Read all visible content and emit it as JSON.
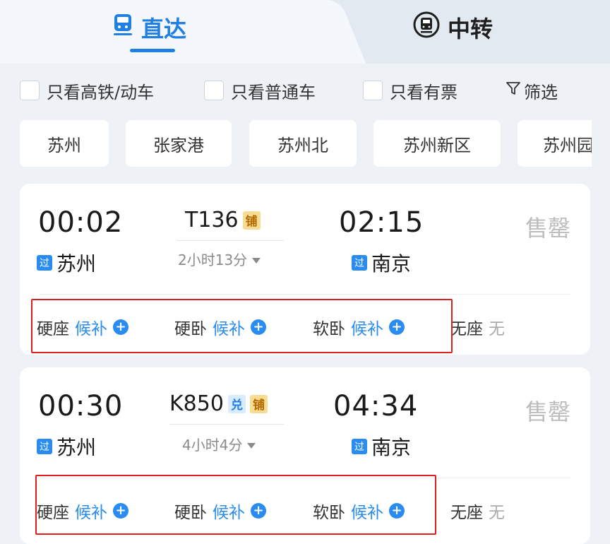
{
  "tabs": {
    "direct": "直达",
    "transfer": "中转"
  },
  "filters": [
    {
      "label": "只看高铁/动车"
    },
    {
      "label": "只看普通车"
    },
    {
      "label": "只看有票"
    }
  ],
  "filter_button": "筛选",
  "stations": [
    "苏州",
    "张家港",
    "苏州北",
    "苏州新区",
    "苏州园区"
  ],
  "trains": [
    {
      "depart_time": "00:02",
      "depart_station": "苏州",
      "depart_tag": "过",
      "train_no": "T136",
      "badges": [
        "铺"
      ],
      "duration": "2小时13分",
      "arrive_time": "02:15",
      "arrive_station": "南京",
      "arrive_tag": "过",
      "status": "售罄",
      "seats": [
        {
          "class": "硬座",
          "status": "候补"
        },
        {
          "class": "硬卧",
          "status": "候补"
        },
        {
          "class": "软卧",
          "status": "候补"
        },
        {
          "class": "无座",
          "status": "无"
        }
      ]
    },
    {
      "depart_time": "00:30",
      "depart_station": "苏州",
      "depart_tag": "过",
      "train_no": "K850",
      "badges": [
        "兑",
        "铺"
      ],
      "duration": "4小时4分",
      "arrive_time": "04:34",
      "arrive_station": "南京",
      "arrive_tag": "过",
      "status": "售罄",
      "seats": [
        {
          "class": "硬座",
          "status": "候补"
        },
        {
          "class": "硬卧",
          "status": "候补"
        },
        {
          "class": "软卧",
          "status": "候补"
        },
        {
          "class": "无座",
          "status": "无"
        }
      ]
    }
  ],
  "colors": {
    "accent": "#1f7fe3",
    "highlight": "#e02020",
    "soldout": "#bcbcbc"
  }
}
